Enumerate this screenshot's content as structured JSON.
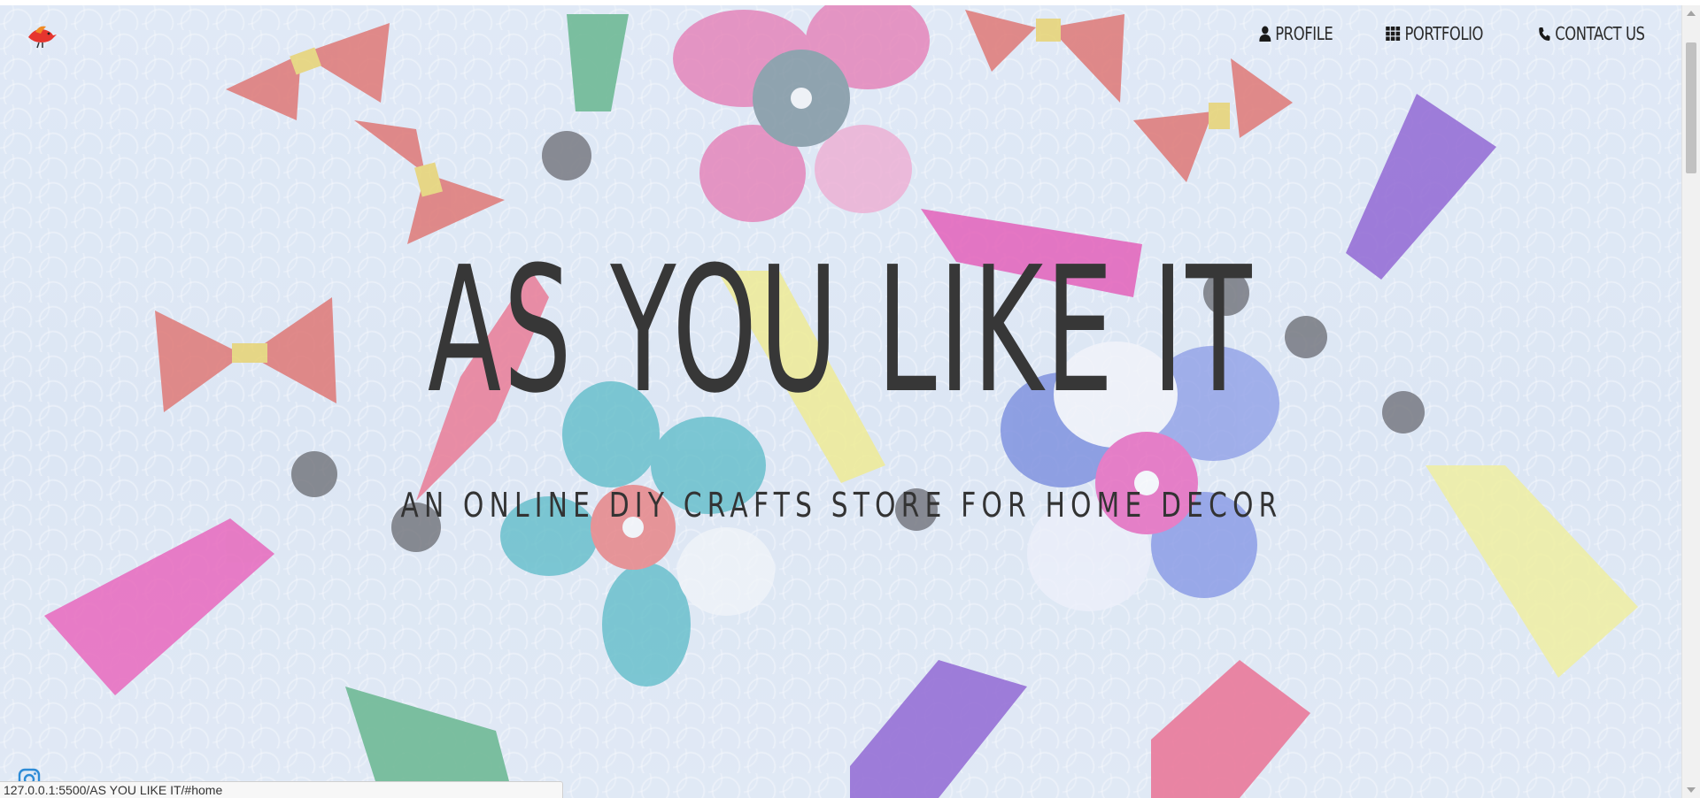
{
  "nav": {
    "items": [
      {
        "label": "PROFILE",
        "icon": "user-icon"
      },
      {
        "label": "PORTFOLIO",
        "icon": "grid-icon"
      },
      {
        "label": "CONTACT US",
        "icon": "phone-icon"
      }
    ]
  },
  "hero": {
    "title": "AS YOU LIKE IT",
    "subtitle": "AN ONLINE DIY CRAFTS STORE FOR HOME DECOR"
  },
  "status": {
    "url": "127.0.0.1:5500/AS YOU LIKE IT/#home"
  },
  "colors": {
    "title": "#373737",
    "background": "#dbe7f5",
    "instagram": "#2d8bd6"
  }
}
